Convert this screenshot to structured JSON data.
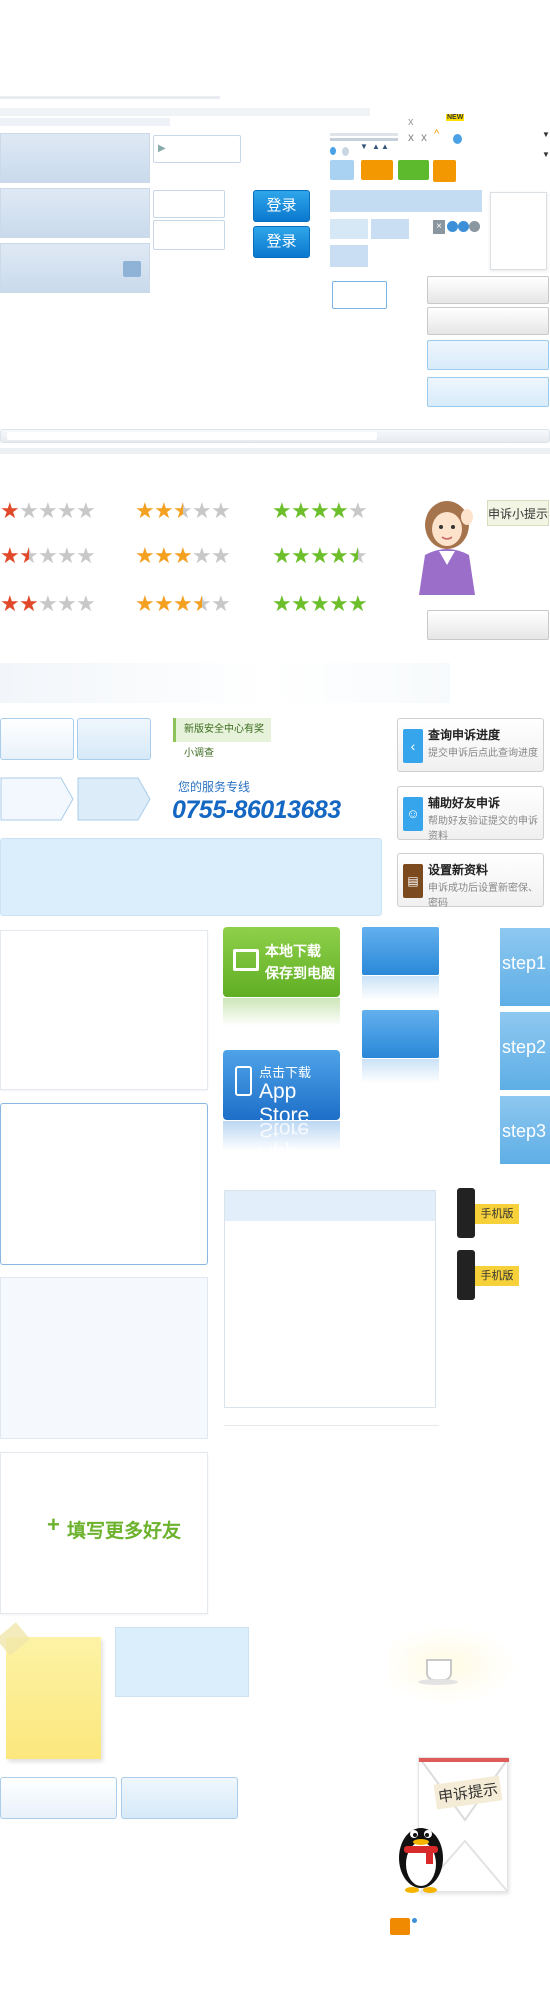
{
  "login": {
    "button1": "登录",
    "button2": "登录"
  },
  "misc": {
    "close_x1": "x",
    "close_x2": "x",
    "close_x3": "x",
    "new_badge": "NEW"
  },
  "tips": {
    "appeal_tip": "申诉小提示",
    "appeal_notice": "申诉提示"
  },
  "survey": {
    "text": "新版安全中心有奖小调查"
  },
  "hotline": {
    "label": "您的服务专线",
    "number": "0755-86013683"
  },
  "services": [
    {
      "title": "查询申诉进度",
      "subtitle": "提交申诉后点此查询进度"
    },
    {
      "title": "辅助好友申诉",
      "subtitle": "帮助好友验证提交的申诉资料"
    },
    {
      "title": "设置新资料",
      "subtitle": "申诉成功后设置新密保、密码"
    }
  ],
  "downloads": {
    "local_line1": "本地下载",
    "local_line2": "保存到电脑",
    "appstore_line1": "点击下载",
    "appstore_line2": "App Store",
    "appstore_reflect": "App Store"
  },
  "steps": [
    "step1",
    "step2",
    "step3"
  ],
  "mobile": {
    "badge1": "手机版",
    "badge2": "手机版"
  },
  "friends": {
    "add_more": "填写更多好友"
  },
  "colors": {
    "accent_blue": "#0a78cf",
    "green": "#6cb22d",
    "orange": "#f39800",
    "star_red": "#e04a2a",
    "star_orange": "#f4a020",
    "star_green": "#6cbf2a"
  },
  "ratings": {
    "red": [
      1,
      1.5,
      2
    ],
    "orange": [
      2.5,
      3,
      3.5
    ],
    "green": [
      4,
      4.5,
      5
    ]
  }
}
